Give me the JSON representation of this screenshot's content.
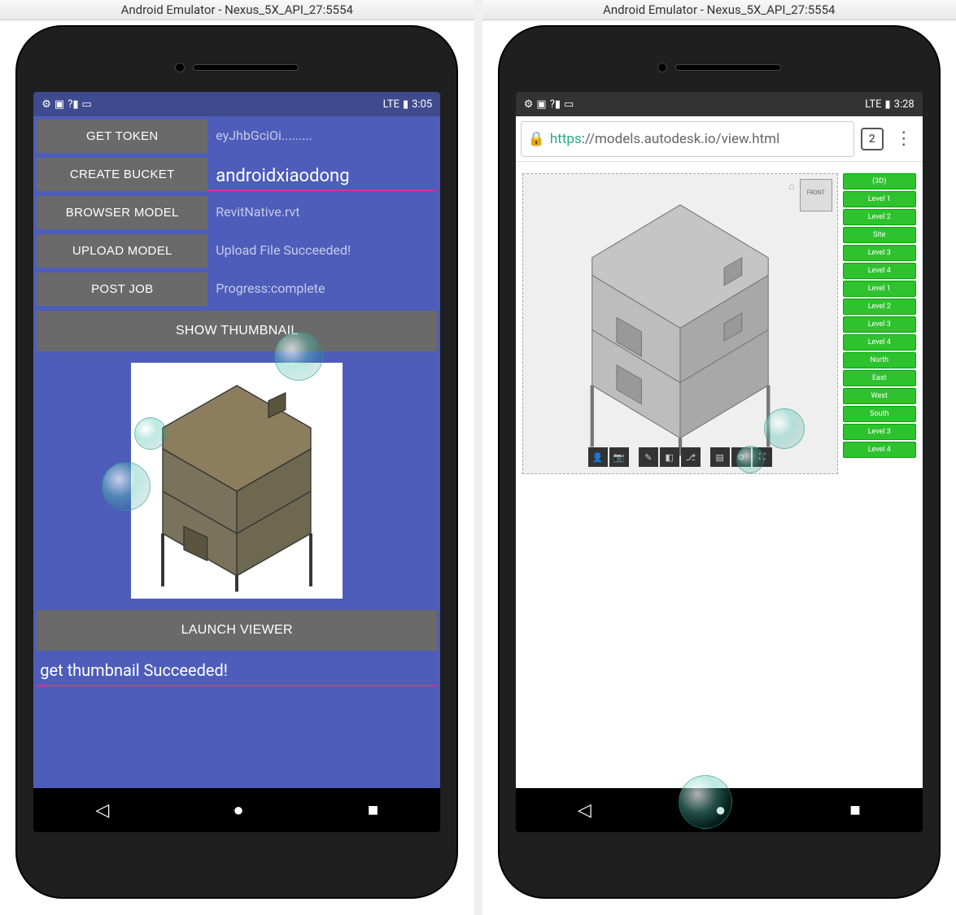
{
  "emulator": {
    "title_left": "Android Emulator - Nexus_5X_API_27:5554",
    "title_right": "Android Emulator - Nexus_5X_API_27:5554"
  },
  "left": {
    "status": {
      "time": "3:05",
      "lte": "LTE"
    },
    "rows": [
      {
        "label": "GET TOKEN",
        "value": "eyJhbGciOi........."
      },
      {
        "label": "CREATE BUCKET",
        "value": "androidxiaodong",
        "input": true
      },
      {
        "label": "BROWSER MODEL",
        "value": "RevitNative.rvt"
      },
      {
        "label": "UPLOAD MODEL",
        "value": "Upload File Succeeded!"
      },
      {
        "label": "POST JOB",
        "value": "Progress:complete"
      }
    ],
    "show_thumb": "SHOW THUMBNAIL",
    "launch_viewer": "LAUNCH VIEWER",
    "status_line": "get thumbnail Succeeded!"
  },
  "right": {
    "status": {
      "time": "3:28",
      "lte": "LTE"
    },
    "url": {
      "https": "https",
      "rest": "://models.autodesk.io/view.html"
    },
    "tab_count": "2",
    "views": [
      "(3D)",
      "Level 1",
      "Level 2",
      "Site",
      "Level 3",
      "Level 4",
      "Level 1",
      "Level 2",
      "Level 3",
      "Level 4",
      "North",
      "East",
      "West",
      "South",
      "Level 3",
      "Level 4"
    ],
    "viewcube": "FRONT"
  }
}
